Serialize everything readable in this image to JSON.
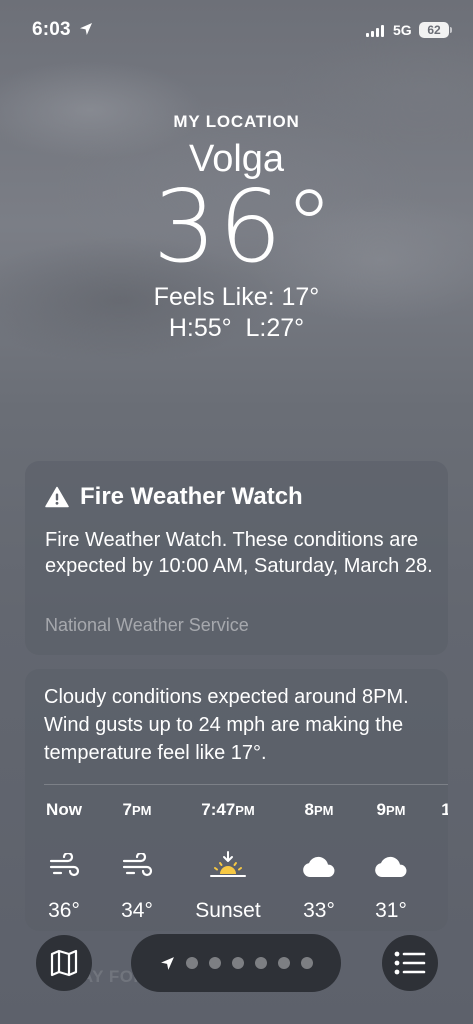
{
  "status_bar": {
    "time": "6:03",
    "network": "5G",
    "battery": "62"
  },
  "location": {
    "label": "MY LOCATION",
    "city": "Volga",
    "temperature": "36°",
    "feels_like": "Feels Like: 17°",
    "high_low": "H:55°  L:27°"
  },
  "alert": {
    "icon": "warning-triangle-icon",
    "title": "Fire Weather Watch",
    "body": "Fire Weather Watch. These conditions are expected by 10:00 AM, Saturday, March 28.",
    "source": "National Weather Service"
  },
  "forecast": {
    "summary": "Cloudy conditions expected around 8PM. Wind gusts up to 24 mph are making the temperature feel like 17°.",
    "hours": [
      {
        "time": "Now",
        "icon": "wind-icon",
        "temp": "36°"
      },
      {
        "time": "7PM",
        "icon": "wind-icon",
        "temp": "34°"
      },
      {
        "time": "7:47PM",
        "icon": "sunset-icon",
        "temp": "Sunset"
      },
      {
        "time": "8PM",
        "icon": "cloud-icon",
        "temp": "33°"
      },
      {
        "time": "9PM",
        "icon": "cloud-icon",
        "temp": "31°"
      },
      {
        "time": "1",
        "icon": "",
        "temp": ""
      }
    ]
  },
  "bottom_bar": {
    "faded_text": "10-DAY FORECAST",
    "map_icon": "map-icon",
    "list_icon": "list-icon",
    "page_dots": 6
  }
}
